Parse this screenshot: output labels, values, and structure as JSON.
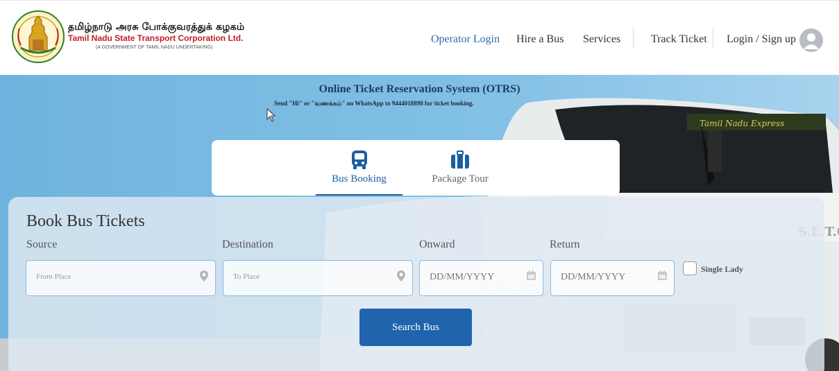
{
  "header": {
    "brand_tamil": "தமிழ்நாடு அரசு போக்குவரத்துக் கழகம்",
    "brand_english": "Tamil Nadu State Transport Corporation Ltd.",
    "brand_sub": "(A GOVERNMENT OF TAMIL NADU UNDERTAKING)",
    "nav": {
      "operator_login": "Operator Login",
      "hire_bus": "Hire a Bus",
      "services": "Services",
      "track_ticket": "Track Ticket",
      "login_signup": "Login / Sign up"
    }
  },
  "hero": {
    "title": "Online Ticket Reservation System (OTRS)",
    "subtitle": "Send \"Hi\" or \"வணக்கம்\" on WhatsApp to 9444018898 for ticket booking."
  },
  "tabs": {
    "bus_booking": "Bus Booking",
    "package_tour": "Package Tour"
  },
  "form": {
    "title": "Book Bus Tickets",
    "source_label": "Source",
    "source_placeholder": "From Place",
    "destination_label": "Destination",
    "destination_placeholder": "To Place",
    "onward_label": "Onward",
    "onward_placeholder": "DD/MM/YYYY",
    "return_label": "Return",
    "return_placeholder": "DD/MM/YYYY",
    "single_lady_label": "Single Lady",
    "search_button": "Search Bus"
  },
  "bus_text": "S.E.T.C",
  "colors": {
    "accent_blue": "#1f64ad",
    "link_blue": "#2e6da4",
    "brand_red": "#c21e25",
    "hero_sky": "#74b8e0"
  }
}
